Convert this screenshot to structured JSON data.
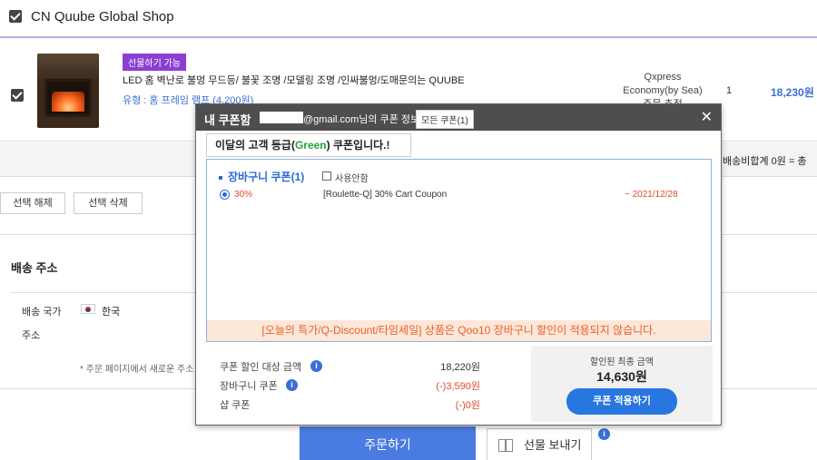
{
  "shop": {
    "name": "CN Quube Global Shop"
  },
  "product": {
    "badge": "선물하기 가능",
    "title": "LED 홈 벽난로 불멍 무드등/ 불꽃 조명 /모델링 조명 /인싸불멍/도매문의는 QUUBE",
    "option": "유형 : 홈 프레임 램프 (4,200원)",
    "shipping_line1": "Qxpress",
    "shipping_line2": "Economy(by Sea)",
    "shipping_line3": "주문 추적",
    "quantity": "1",
    "price": "18,230원"
  },
  "summary": {
    "text": "배송비합계 0원 = 총"
  },
  "buttons": {
    "deselect": "선택 해제",
    "delete_selected": "선택 삭제",
    "order": "주문하기",
    "send_gift": "선물 보내기"
  },
  "address": {
    "title": "배송 주소",
    "country_label": "배송 국가",
    "country_value": "한국",
    "address_label": "주소",
    "note": "* 주문 페이지에서 새로운 주소"
  },
  "modal": {
    "title": "내 쿠폰함",
    "email_suffix": "@gmail.com님의 쿠폰 정보",
    "all_coupons": "모든 쿠폰(1)",
    "close": "✕",
    "grade_prefix": "이달의 고객 등급(",
    "grade_name": "Green",
    "grade_suffix": ") 쿠폰입니다.!",
    "cart_coupon_title": "장바구니 쿠폰(1)",
    "not_use_label": "사용안함",
    "coupon": {
      "percent": "30%",
      "name": "[Roulette-Q] 30% Cart Coupon",
      "expiry": "~ 2021/12/28"
    },
    "warning": "[오늘의 특가/Q-Discount/타임세일] 상품은 Qoo10 장바구니 할인이 적용되지 않습니다.",
    "calc": [
      {
        "label": "쿠폰 할인 대상 금액",
        "value": "18,220원",
        "info": true,
        "red": false
      },
      {
        "label": "장바구니 쿠폰",
        "value": "(-)3,590원",
        "info": true,
        "red": true
      },
      {
        "label": "샵 쿠폰",
        "value": "(-)0원",
        "info": false,
        "red": true
      }
    ],
    "final_label": "할인된 최종 금액",
    "final_amount": "14,630원",
    "apply_button": "쿠폰 적용하기"
  },
  "colors": {
    "accent": "#2877e0",
    "warning": "#e8602a",
    "grade": "#22a33a"
  }
}
